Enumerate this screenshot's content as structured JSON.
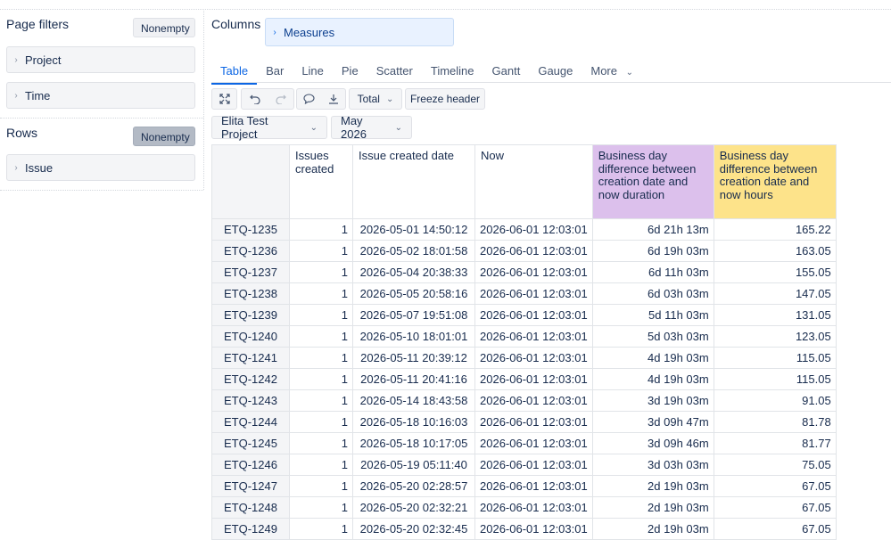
{
  "left_panel": {
    "page_filters_title": "Page filters",
    "page_filters_nonempty": "Nonempty",
    "page_filters": [
      {
        "label": "Project"
      },
      {
        "label": "Time"
      }
    ],
    "rows_title": "Rows",
    "rows_nonempty": "Nonempty",
    "rows": [
      {
        "label": "Issue"
      }
    ]
  },
  "columns": {
    "title": "Columns",
    "measures_label": "Measures"
  },
  "tabs": [
    "Table",
    "Bar",
    "Line",
    "Pie",
    "Scatter",
    "Timeline",
    "Gantt",
    "Gauge",
    "More"
  ],
  "active_tab": "Table",
  "toolbar": {
    "total_label": "Total",
    "freeze_label": "Freeze header",
    "icons": [
      "expand-icon",
      "undo-icon",
      "redo-icon",
      "comment-icon",
      "download-icon"
    ]
  },
  "selectors": {
    "project": "Elita Test Project",
    "period": "May 2026"
  },
  "colors": {
    "accent": "#0c66e4",
    "duration_header": "#dcc0ec",
    "hours_header": "#fde38a"
  },
  "table": {
    "headers": [
      "",
      "Issues created",
      "Issue created date",
      "Now",
      "Business day difference between creation date and now duration",
      "Business day difference between creation date and now hours"
    ],
    "rows": [
      [
        "ETQ-1235",
        "1",
        "2026-05-01 14:50:12",
        "2026-06-01 12:03:01",
        "6d 21h 13m",
        "165.22"
      ],
      [
        "ETQ-1236",
        "1",
        "2026-05-02 18:01:58",
        "2026-06-01 12:03:01",
        "6d 19h 03m",
        "163.05"
      ],
      [
        "ETQ-1237",
        "1",
        "2026-05-04 20:38:33",
        "2026-06-01 12:03:01",
        "6d 11h 03m",
        "155.05"
      ],
      [
        "ETQ-1238",
        "1",
        "2026-05-05 20:58:16",
        "2026-06-01 12:03:01",
        "6d 03h 03m",
        "147.05"
      ],
      [
        "ETQ-1239",
        "1",
        "2026-05-07 19:51:08",
        "2026-06-01 12:03:01",
        "5d 11h 03m",
        "131.05"
      ],
      [
        "ETQ-1240",
        "1",
        "2026-05-10 18:01:01",
        "2026-06-01 12:03:01",
        "5d 03h 03m",
        "123.05"
      ],
      [
        "ETQ-1241",
        "1",
        "2026-05-11 20:39:12",
        "2026-06-01 12:03:01",
        "4d 19h 03m",
        "115.05"
      ],
      [
        "ETQ-1242",
        "1",
        "2026-05-11 20:41:16",
        "2026-06-01 12:03:01",
        "4d 19h 03m",
        "115.05"
      ],
      [
        "ETQ-1243",
        "1",
        "2026-05-14 18:43:58",
        "2026-06-01 12:03:01",
        "3d 19h 03m",
        "91.05"
      ],
      [
        "ETQ-1244",
        "1",
        "2026-05-18 10:16:03",
        "2026-06-01 12:03:01",
        "3d 09h 47m",
        "81.78"
      ],
      [
        "ETQ-1245",
        "1",
        "2026-05-18 10:17:05",
        "2026-06-01 12:03:01",
        "3d 09h 46m",
        "81.77"
      ],
      [
        "ETQ-1246",
        "1",
        "2026-05-19 05:11:40",
        "2026-06-01 12:03:01",
        "3d 03h 03m",
        "75.05"
      ],
      [
        "ETQ-1247",
        "1",
        "2026-05-20 02:28:57",
        "2026-06-01 12:03:01",
        "2d 19h 03m",
        "67.05"
      ],
      [
        "ETQ-1248",
        "1",
        "2026-05-20 02:32:21",
        "2026-06-01 12:03:01",
        "2d 19h 03m",
        "67.05"
      ],
      [
        "ETQ-1249",
        "1",
        "2026-05-20 02:32:45",
        "2026-06-01 12:03:01",
        "2d 19h 03m",
        "67.05"
      ]
    ]
  }
}
